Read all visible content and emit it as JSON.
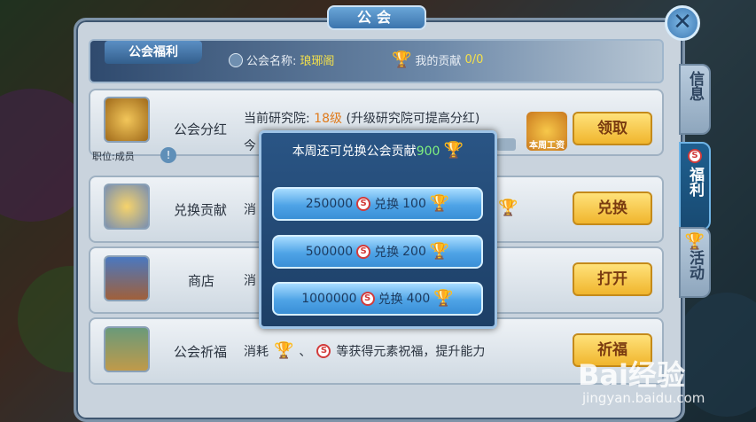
{
  "title": "公会",
  "header": {
    "tab": "公会福利",
    "guild_name_label": "公会名称:",
    "guild_name": "琅琊阁",
    "contribution_label": "我的贡献",
    "contribution_value": "0/0"
  },
  "rows": [
    {
      "label": "公会分红",
      "desc_prefix": "当前研究院:",
      "desc_level": "18级",
      "desc_suffix": "(升级研究院可提高分红)",
      "desc_line2": "今",
      "sub_label": "职位:成员",
      "button": "领取",
      "badge": "本周工资"
    },
    {
      "label": "兑换贡献",
      "desc": "消",
      "button": "兑换"
    },
    {
      "label": "商店",
      "desc": "消",
      "button": "打开"
    },
    {
      "label": "公会祈福",
      "desc": "消耗",
      "desc_sep": "、",
      "desc_tail": "等获得元素祝福，提升能力",
      "button": "祈福"
    }
  ],
  "side_tabs": [
    "信息",
    "福利",
    "活动"
  ],
  "popup": {
    "title_prefix": "本周还可兑换公会贡献",
    "title_num": "900",
    "options": [
      {
        "cost": "250000",
        "action": "兑换",
        "gain": "100"
      },
      {
        "cost": "500000",
        "action": "兑换",
        "gain": "200"
      },
      {
        "cost": "1000000",
        "action": "兑换",
        "gain": "400"
      }
    ]
  },
  "watermark": {
    "brand": "Bai经验",
    "url": "jingyan.baidu.com"
  },
  "colors": {
    "gold": "#f0b52d",
    "popup": "#1d3f66",
    "accent_green": "#7ff07f",
    "level_orange": "#e07a1a"
  }
}
